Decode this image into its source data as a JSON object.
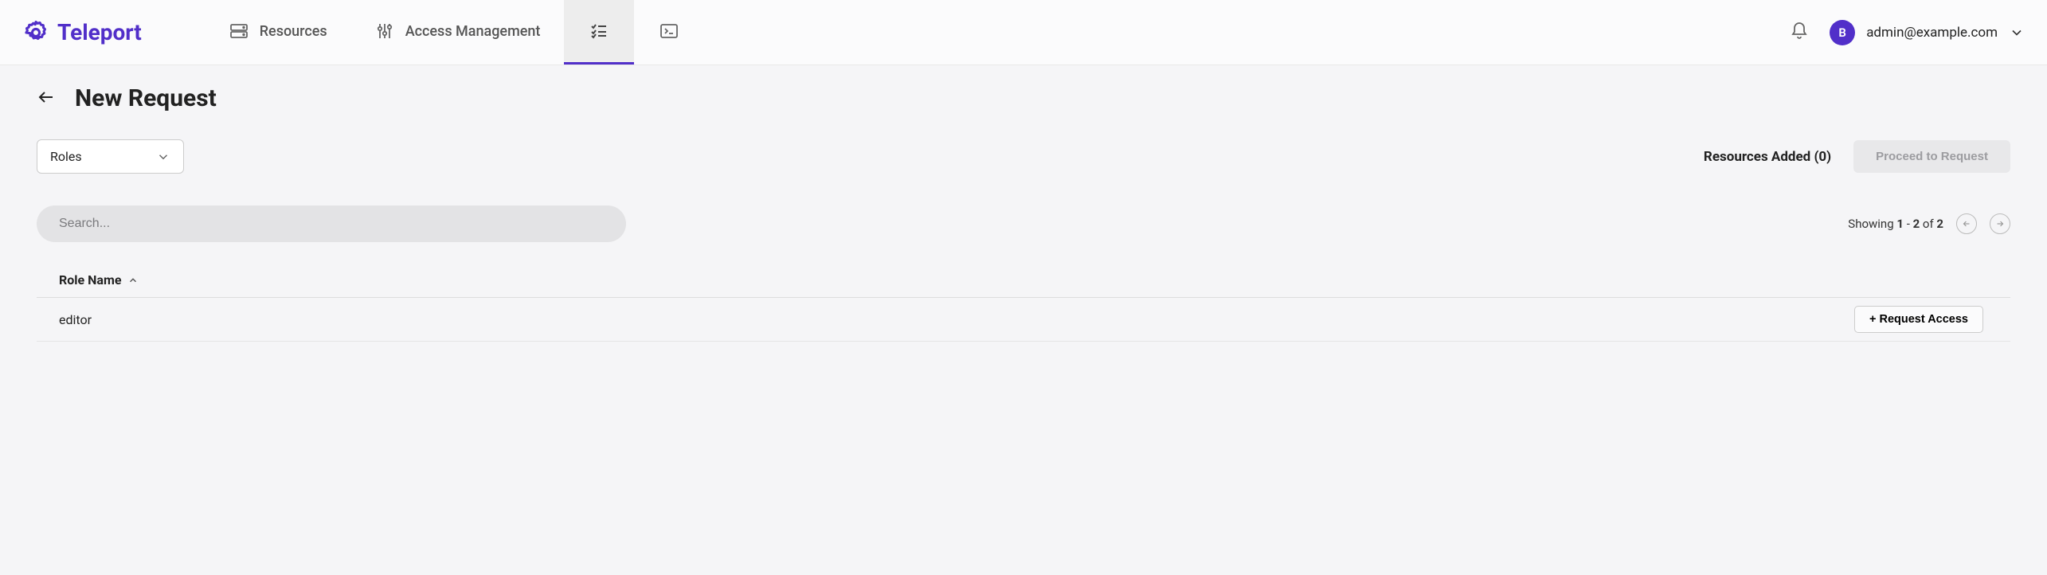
{
  "brand": {
    "name": "Teleport"
  },
  "nav": {
    "resources": "Resources",
    "access_mgmt": "Access Management"
  },
  "user": {
    "initial": "B",
    "email": "admin@example.com"
  },
  "page": {
    "title": "New Request"
  },
  "filter": {
    "dropdown_label": "Roles"
  },
  "summary": {
    "resources_added_label": "Resources Added (0)",
    "proceed_label": "Proceed to Request"
  },
  "search": {
    "placeholder": "Search..."
  },
  "pagination": {
    "prefix": "Showing ",
    "start": "1",
    "dash": " - ",
    "end": "2",
    "of": " of ",
    "total": "2"
  },
  "table": {
    "column_header": "Role Name",
    "rows": [
      {
        "name": "editor",
        "action_label": "+ Request Access"
      }
    ]
  }
}
